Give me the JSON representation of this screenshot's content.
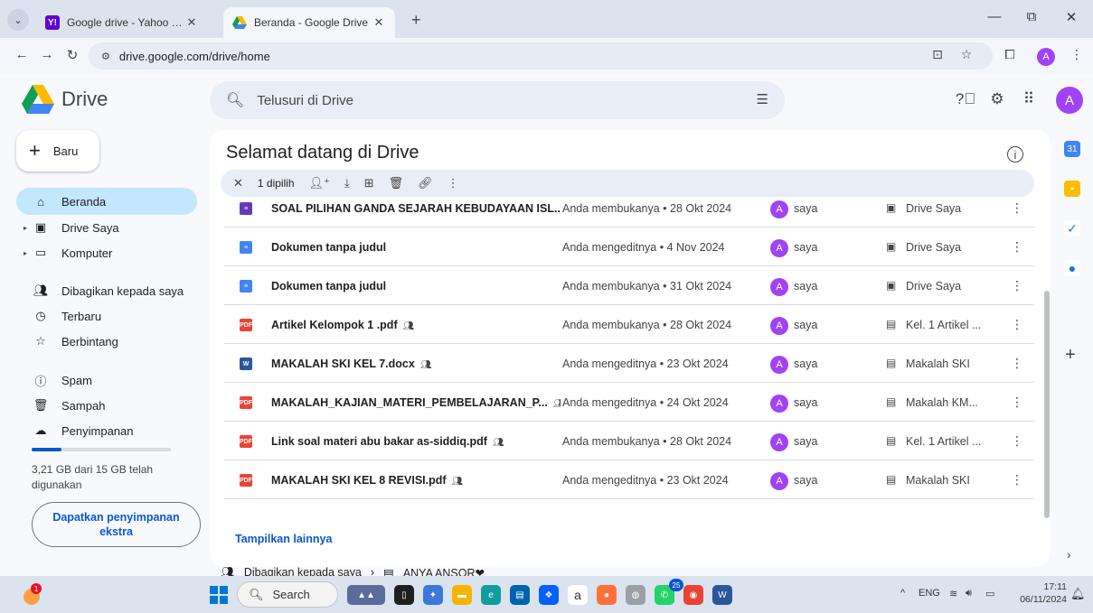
{
  "browser": {
    "tabs": [
      {
        "title": "Google drive - Yahoo Hasil Pencarian",
        "active": false
      },
      {
        "title": "Beranda - Google Drive",
        "active": true
      }
    ],
    "url": "drive.google.com/drive/home"
  },
  "drive": {
    "logo_text": "Drive",
    "search_placeholder": "Telusuri di Drive",
    "avatar_letter": "A",
    "new_label": "Baru",
    "sidebar": [
      {
        "label": "Beranda",
        "icon": "home-icon",
        "active": true
      },
      {
        "label": "Drive Saya",
        "icon": "my-drive-icon"
      },
      {
        "label": "Komputer",
        "icon": "computer-icon"
      },
      {
        "label": "Dibagikan kepada saya",
        "icon": "shared-icon"
      },
      {
        "label": "Terbaru",
        "icon": "clock-icon"
      },
      {
        "label": "Berbintang",
        "icon": "star-icon"
      },
      {
        "label": "Spam",
        "icon": "spam-icon"
      },
      {
        "label": "Sampah",
        "icon": "trash-icon"
      },
      {
        "label": "Penyimpanan",
        "icon": "cloud-icon"
      }
    ],
    "storage": {
      "text": "3,21 GB dari 15 GB telah digunakan",
      "used_fraction": 0.214
    },
    "get_storage_label": "Dapatkan penyimpanan ekstra",
    "welcome_title": "Selamat datang di Drive",
    "selection": {
      "count_label": "1 dipilih"
    },
    "files": [
      {
        "name": "SOAL PILIHAN GANDA SEJARAH KEBUDAYAAN ISL...",
        "type": "form",
        "shared": false,
        "activity": "Anda membukanya • 28 Okt 2024",
        "owner": "saya",
        "location": "Drive Saya",
        "loc_icon": "my-drive-icon"
      },
      {
        "name": "Dokumen tanpa judul",
        "type": "doc",
        "shared": false,
        "activity": "Anda mengeditnya • 4 Nov 2024",
        "owner": "saya",
        "location": "Drive Saya",
        "loc_icon": "my-drive-icon"
      },
      {
        "name": "Dokumen tanpa judul",
        "type": "doc",
        "shared": false,
        "activity": "Anda membukanya • 31 Okt 2024",
        "owner": "saya",
        "location": "Drive Saya",
        "loc_icon": "my-drive-icon"
      },
      {
        "name": "Artikel Kelompok 1 .pdf",
        "type": "pdf",
        "shared": true,
        "activity": "Anda membukanya • 28 Okt 2024",
        "owner": "saya",
        "location": "Kel. 1 Artikel ...",
        "loc_icon": "shared-folder-icon"
      },
      {
        "name": "MAKALAH SKI KEL 7.docx",
        "type": "word",
        "shared": true,
        "activity": "Anda mengeditnya • 23 Okt 2024",
        "owner": "saya",
        "location": "Makalah SKI",
        "loc_icon": "shared-folder-icon"
      },
      {
        "name": "MAKALAH_KAJIAN_MATERI_PEMBELAJARAN_P...",
        "type": "pdf",
        "shared": true,
        "activity": "Anda mengeditnya • 24 Okt 2024",
        "owner": "saya",
        "location": "Makalah KM...",
        "loc_icon": "shared-folder-icon"
      },
      {
        "name": "Link soal materi abu bakar as-siddiq.pdf",
        "type": "pdf",
        "shared": true,
        "activity": "Anda membukanya • 28 Okt 2024",
        "owner": "saya",
        "location": "Kel. 1 Artikel ...",
        "loc_icon": "shared-folder-icon"
      },
      {
        "name": "MAKALAH SKI KEL 8 REVISI.pdf",
        "type": "pdf",
        "shared": true,
        "activity": "Anda mengeditnya • 23 Okt 2024",
        "owner": "saya",
        "location": "Makalah SKI",
        "loc_icon": "shared-folder-icon"
      }
    ],
    "show_more_label": "Tampilkan lainnya",
    "breadcrumb": {
      "first": "Dibagikan kepada saya",
      "second": "ANYA ANSOR❤"
    }
  },
  "taskbar": {
    "search_placeholder": "Search",
    "weather_badge": "1",
    "chrome_badge": "25",
    "lang": "ENG",
    "time": "17:11",
    "date": "06/11/2024"
  },
  "colors": {
    "accent": "#0b57d0",
    "selected_nav": "#c2e7ff",
    "avatar": "#a142f4",
    "pdf": "#ea4335",
    "doc": "#4285f4",
    "word": "#2b579a",
    "form": "#673ab7"
  }
}
